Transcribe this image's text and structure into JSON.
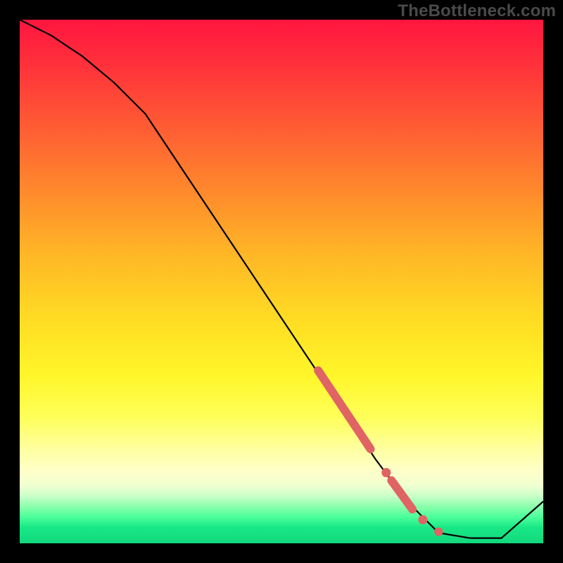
{
  "watermark": "TheBottleneck.com",
  "chart_data": {
    "type": "line",
    "title": "",
    "xlabel": "",
    "ylabel": "",
    "xlim": [
      0,
      100
    ],
    "ylim": [
      0,
      100
    ],
    "series": [
      {
        "name": "curve",
        "x": [
          0,
          6,
          12,
          18,
          24,
          30,
          40,
          50,
          60,
          68,
          74,
          80,
          86,
          92,
          100
        ],
        "y": [
          100,
          97,
          93,
          88,
          82,
          73,
          58,
          43,
          28,
          16,
          8,
          2,
          1,
          1,
          8
        ]
      }
    ],
    "markers": [
      {
        "name": "marker-segment-1",
        "x_range": [
          57,
          67
        ],
        "y_range": [
          33,
          18
        ],
        "style": "thick"
      },
      {
        "name": "marker-dot-1",
        "x": 70,
        "y": 13.5,
        "r": 4
      },
      {
        "name": "marker-segment-2",
        "x_range": [
          71,
          75
        ],
        "y_range": [
          12,
          6.5
        ],
        "style": "thick"
      },
      {
        "name": "marker-dot-2",
        "x": 77,
        "y": 4.5,
        "r": 4
      },
      {
        "name": "marker-dot-3",
        "x": 80,
        "y": 2.2,
        "r": 3.5
      }
    ],
    "colors": {
      "curve": "#000000",
      "marker": "#e06464"
    }
  }
}
